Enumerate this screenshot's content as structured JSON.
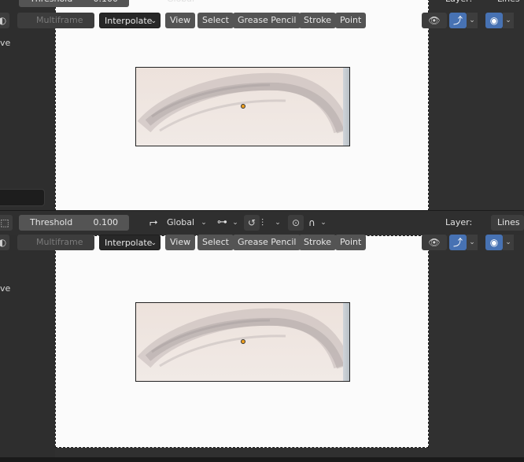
{
  "snap_bar": {
    "threshold_label": "Threshold",
    "threshold_value": "0.100",
    "orientation_value": "Global",
    "layer_label": "Layer:",
    "layer_value": "Lines"
  },
  "tool_header": {
    "multiframe_label": "Multiframe",
    "interpolate_label": "Interpolate",
    "menus": [
      "View",
      "Select",
      "Grease Pencil",
      "Stroke",
      "Point"
    ]
  },
  "left_panel": {
    "partial_label": "ve"
  },
  "icons": {
    "snap": "magnet-icon",
    "transform": "transform-axes-icon",
    "pivot": "pivot-chain-icon",
    "proportional": "proportional-edit-icon",
    "falloff": "falloff-curve-icon",
    "visibility": "eye-icon",
    "gizmo": "gizmo-icon",
    "overlay": "overlay-icon"
  },
  "colors": {
    "header_bg": "#2f2f2f",
    "button_bg": "#545454",
    "active_blue": "#4772b3",
    "pivot_dot": "#f0a020"
  }
}
